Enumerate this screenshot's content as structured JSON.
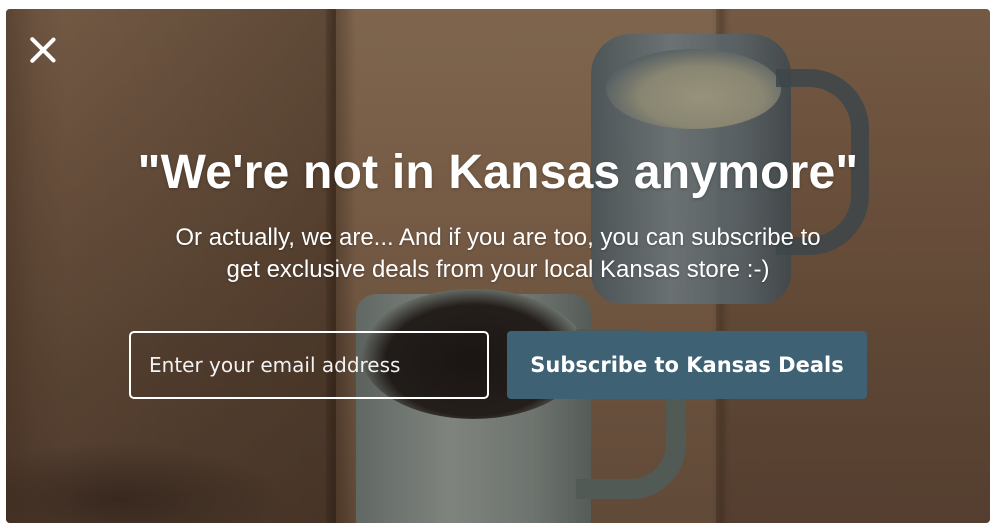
{
  "popup": {
    "headline": "\"We're not in Kansas anymore\"",
    "subtext_line1": "Or actually, we are... And if you are too, you can subscribe to",
    "subtext_line2": "get exclusive deals from your local Kansas store :-)",
    "email_placeholder": "Enter your email address",
    "email_value": "",
    "subscribe_label": "Subscribe to Kansas Deals",
    "close_icon": "close-icon"
  },
  "colors": {
    "button_bg": "#3e6173",
    "text": "#ffffff"
  }
}
